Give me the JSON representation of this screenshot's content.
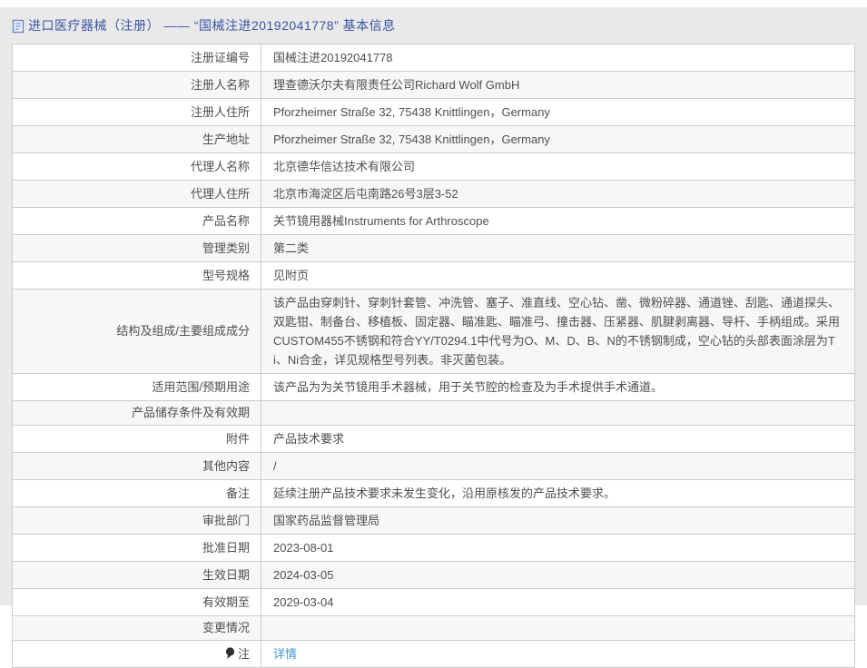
{
  "header": {
    "icon": "document-icon",
    "title": "进口医疗器械（注册） —— “国械注进20192041778” 基本信息"
  },
  "colors": {
    "page_background": "#e9e9e9",
    "title_blue": "#3c55a4",
    "link_blue": "#3e97d1",
    "alt_row": "#f7f7f7",
    "border": "#cccccc"
  },
  "table": {
    "rows": [
      {
        "label": "注册证编号",
        "value": "国械注进20192041778"
      },
      {
        "label": "注册人名称",
        "value": "理查德沃尔夫有限责任公司Richard Wolf GmbH"
      },
      {
        "label": "注册人住所",
        "value": "Pforzheimer Straße 32, 75438 Knittlingen，Germany"
      },
      {
        "label": "生产地址",
        "value": "Pforzheimer Straße 32, 75438 Knittlingen，Germany"
      },
      {
        "label": "代理人名称",
        "value": "北京德华信达技术有限公司"
      },
      {
        "label": "代理人住所",
        "value": "北京市海淀区后屯南路26号3层3-52"
      },
      {
        "label": "产品名称",
        "value": "关节镜用器械Instruments for Arthroscope"
      },
      {
        "label": "管理类别",
        "value": "第二类"
      },
      {
        "label": "型号规格",
        "value": "见附页"
      },
      {
        "label": "结构及组成/主要组成成分",
        "value": "该产品由穿刺针、穿刺针套管、冲洗管、塞子、准直线、空心钻、凿、微粉碎器、通道锉、刮匙、通道探头、双匙钳、制备台、移植板、固定器、瞄准匙、瞄准弓、撞击器、压紧器、肌腱剥离器、导杆、手柄组成。采用CUSTOM455不锈钢和符合YY/T0294.1中代号为O、M、D、B、N的不锈钢制成，空心钻的头部表面涂层为Ti、Ni合金，详见规格型号列表。非灭菌包装。"
      },
      {
        "label": "适用范围/预期用途",
        "value": "该产品为为关节镜用手术器械，用于关节腔的检查及为手术提供手术通道。"
      },
      {
        "label": "产品储存条件及有效期",
        "value": ""
      },
      {
        "label": "附件",
        "value": "产品技术要求"
      },
      {
        "label": "其他内容",
        "value": "/"
      },
      {
        "label": "备注",
        "value": "延续注册产品技术要求未发生变化，沿用原核发的产品技术要求。"
      },
      {
        "label": "审批部门",
        "value": "国家药品监督管理局"
      },
      {
        "label": "批准日期",
        "value": "2023-08-01"
      },
      {
        "label": "生效日期",
        "value": "2024-03-05"
      },
      {
        "label": "有效期至",
        "value": "2029-03-04"
      },
      {
        "label": "变更情况",
        "value": ""
      },
      {
        "label": "注",
        "label_icon": "location-pin-icon",
        "value": "详情",
        "link": true
      }
    ]
  }
}
